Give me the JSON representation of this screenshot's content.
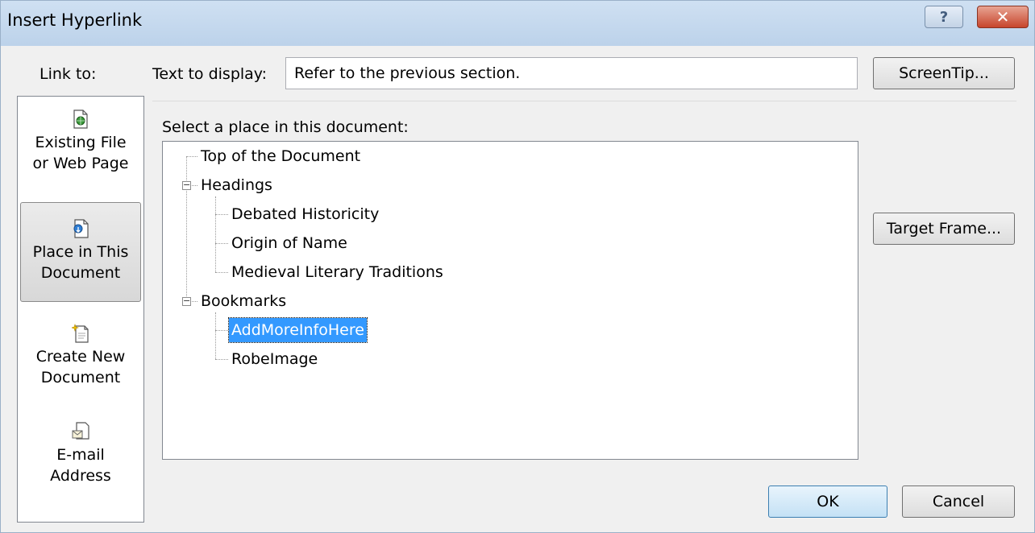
{
  "dialog": {
    "title": "Insert Hyperlink",
    "help_glyph": "?",
    "close_glyph": "✕"
  },
  "sidebar": {
    "label": "Link to:",
    "items": [
      {
        "line1": "Existing File",
        "line2": "or Web Page",
        "icon": "existing-file-icon",
        "selected": false
      },
      {
        "line1": "Place in This",
        "line2": "Document",
        "icon": "place-in-document-icon",
        "selected": true
      },
      {
        "line1": "Create New",
        "line2": "Document",
        "icon": "new-document-icon",
        "selected": false
      },
      {
        "line1": "E-mail",
        "line2": "Address",
        "icon": "email-icon",
        "selected": false
      }
    ]
  },
  "text_to_display": {
    "label": "Text to display:",
    "value": "Refer to the previous section."
  },
  "buttons": {
    "screentip": "ScreenTip...",
    "target_frame": "Target Frame...",
    "ok": "OK",
    "cancel": "Cancel"
  },
  "place": {
    "label": "Select a place in this document:",
    "tree": {
      "top": "Top of the Document",
      "headings": {
        "label": "Headings",
        "children": [
          "Debated Historicity",
          "Origin of Name",
          "Medieval Literary Traditions"
        ]
      },
      "bookmarks": {
        "label": "Bookmarks",
        "children": [
          "AddMoreInfoHere",
          "RobeImage"
        ]
      },
      "selected": "AddMoreInfoHere"
    }
  },
  "colors": {
    "selection": "#3399ff",
    "titlebar": "#c5d8ee",
    "close": "#c7452c"
  }
}
